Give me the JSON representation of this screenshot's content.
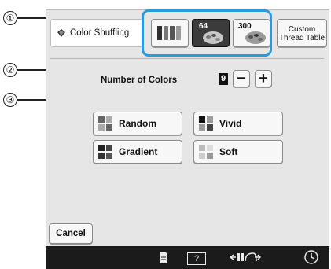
{
  "callouts": [
    "①",
    "②",
    "③"
  ],
  "header": {
    "title": "Color Shuffling"
  },
  "palette_buttons": {
    "btn2_label": "64",
    "btn3_label": "300"
  },
  "custom_button": {
    "label_line1": "Custom",
    "label_line2": "Thread Table"
  },
  "number_of_colors": {
    "label": "Number of Colors",
    "value": "9",
    "minus_label": "−",
    "plus_label": "+"
  },
  "options": [
    {
      "label": "Random"
    },
    {
      "label": "Vivid"
    },
    {
      "label": "Gradient"
    },
    {
      "label": "Soft"
    }
  ],
  "cancel_label": "Cancel",
  "bottom_bar": {
    "icons": [
      "document-icon",
      "help-icon",
      "thread-tension-icon",
      "clock-icon"
    ],
    "help_icon_text": "?"
  },
  "colors": {
    "highlight": "#2a9ae0",
    "selected_button": "#3b3b3b",
    "screen_bg": "#e6e6e6",
    "bar_bg": "#1b1b1b"
  }
}
